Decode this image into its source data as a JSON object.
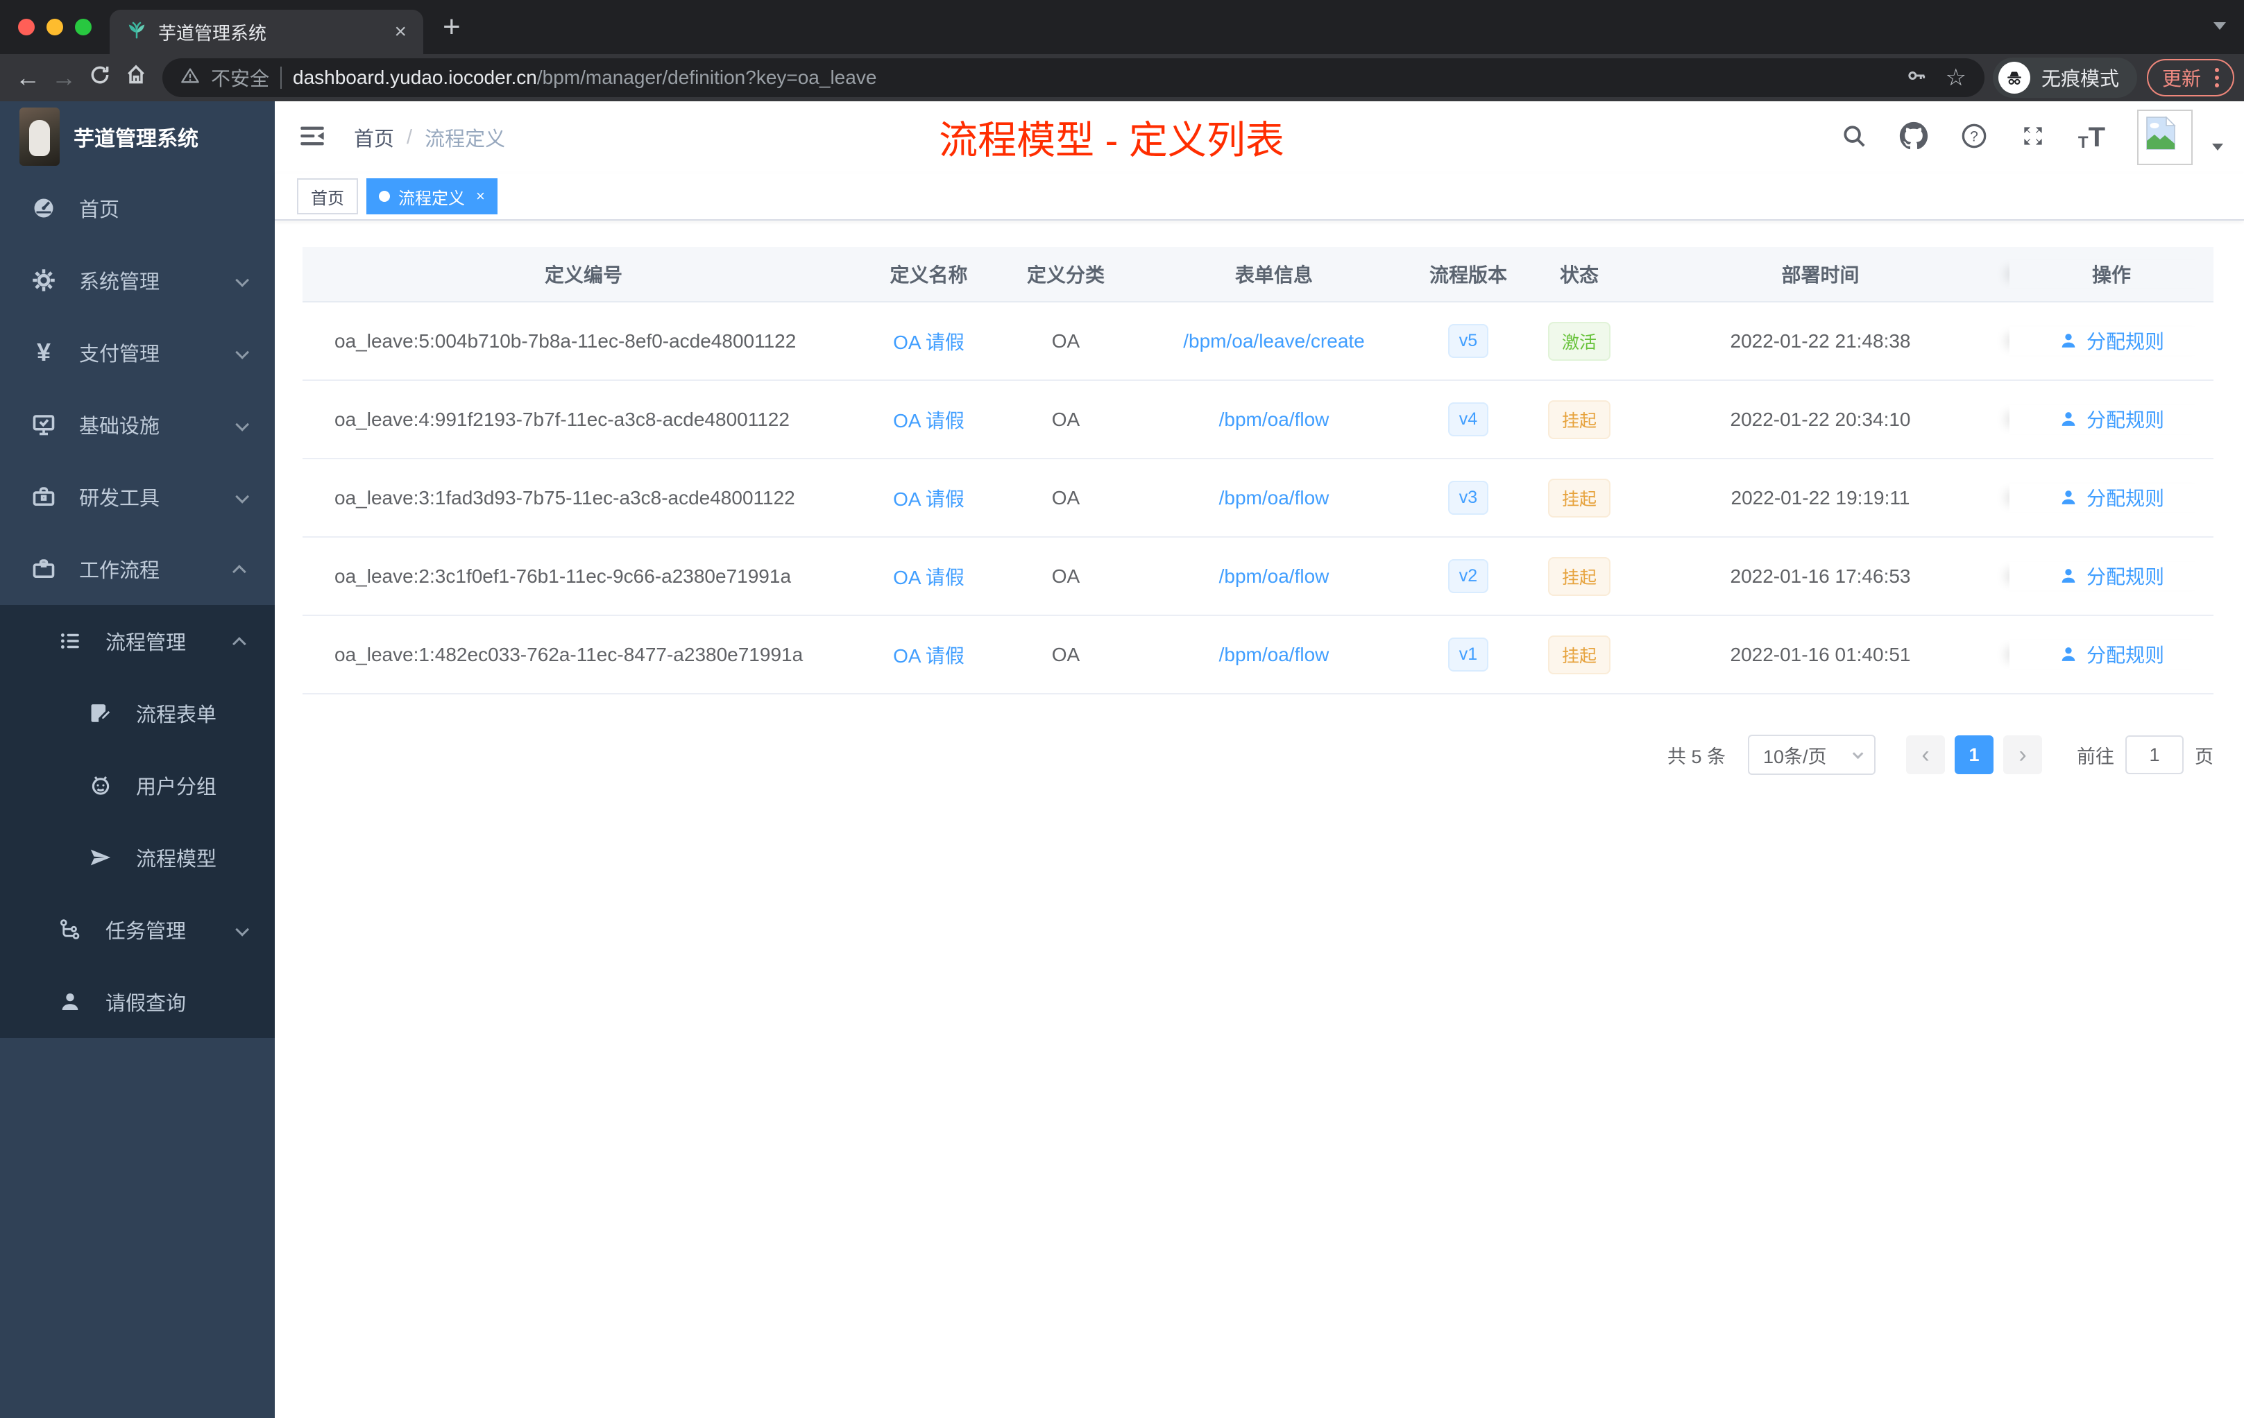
{
  "colors": {
    "accent": "#409eff",
    "success": "#67c23a",
    "warning": "#e6a23c",
    "annotation_red": "#ff2d00",
    "sidebar_bg": "#304156",
    "submenu_bg": "#1f2d3d",
    "update_salmon": "#f28b82"
  },
  "browser": {
    "tab_title": "芋道管理系统",
    "not_secure": "不安全",
    "url_host": "dashboard.yudao.iocoder.cn",
    "url_path": "/bpm/manager/definition?key=oa_leave",
    "incognito_label": "无痕模式",
    "update_label": "更新"
  },
  "sidebar": {
    "brand": "芋道管理系统",
    "items": [
      {
        "label": "首页"
      },
      {
        "label": "系统管理"
      },
      {
        "label": "支付管理"
      },
      {
        "label": "基础设施"
      },
      {
        "label": "研发工具"
      },
      {
        "label": "工作流程"
      },
      {
        "label": "流程管理"
      },
      {
        "label": "流程表单"
      },
      {
        "label": "用户分组"
      },
      {
        "label": "流程模型"
      },
      {
        "label": "任务管理"
      },
      {
        "label": "请假查询"
      }
    ]
  },
  "navbar": {
    "breadcrumb_home": "首页",
    "breadcrumb_sep": "/",
    "breadcrumb_current": "流程定义",
    "annotation": "流程模型 - 定义列表"
  },
  "tags": {
    "home": "首页",
    "active": "流程定义"
  },
  "table": {
    "columns": [
      "定义编号",
      "定义名称",
      "定义分类",
      "表单信息",
      "流程版本",
      "状态",
      "部署时间",
      "操作"
    ],
    "action_label": "分配规则",
    "rows": [
      {
        "id": "oa_leave:5:004b710b-7b8a-11ec-8ef0-acde48001122",
        "name": "OA 请假",
        "category": "OA",
        "form": "/bpm/oa/leave/create",
        "version": "v5",
        "status": "激活",
        "time": "2022-01-22 21:48:38"
      },
      {
        "id": "oa_leave:4:991f2193-7b7f-11ec-a3c8-acde48001122",
        "name": "OA 请假",
        "category": "OA",
        "form": "/bpm/oa/flow",
        "version": "v4",
        "status": "挂起",
        "time": "2022-01-22 20:34:10"
      },
      {
        "id": "oa_leave:3:1fad3d93-7b75-11ec-a3c8-acde48001122",
        "name": "OA 请假",
        "category": "OA",
        "form": "/bpm/oa/flow",
        "version": "v3",
        "status": "挂起",
        "time": "2022-01-22 19:19:11"
      },
      {
        "id": "oa_leave:2:3c1f0ef1-76b1-11ec-9c66-a2380e71991a",
        "name": "OA 请假",
        "category": "OA",
        "form": "/bpm/oa/flow",
        "version": "v2",
        "status": "挂起",
        "time": "2022-01-16 17:46:53"
      },
      {
        "id": "oa_leave:1:482ec033-762a-11ec-8477-a2380e71991a",
        "name": "OA 请假",
        "category": "OA",
        "form": "/bpm/oa/flow",
        "version": "v1",
        "status": "挂起",
        "time": "2022-01-16 01:40:51"
      }
    ]
  },
  "pagination": {
    "total": "共 5 条",
    "page_size": "10条/页",
    "prev": "‹",
    "next": "›",
    "page": "1",
    "goto_label": "前往",
    "goto_value": "1",
    "page_unit": "页"
  }
}
